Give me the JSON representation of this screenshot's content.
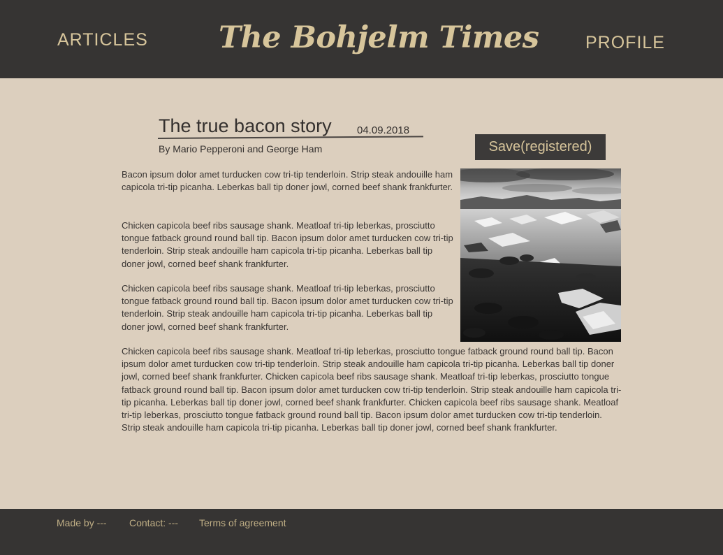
{
  "header": {
    "site_title": "The Bohjelm Times",
    "nav_articles": "ARTICLES",
    "nav_profile": "PROFILE"
  },
  "article": {
    "title": "The true bacon story",
    "date": "04.09.2018",
    "byline": "By Mario Pepperoni and George Ham",
    "save_label": "Save(registered)",
    "paragraphs": [
      "Bacon ipsum dolor amet turducken cow tri-tip tenderloin. Strip steak andouille ham capicola tri-tip picanha. Leberkas ball tip doner jowl, corned beef shank frankfurter.",
      "Chicken capicola beef ribs sausage shank. Meatloaf tri-tip leberkas, prosciutto tongue fatback ground round ball tip. Bacon ipsum dolor amet turducken cow tri-tip tenderloin. Strip steak andouille ham capicola tri-tip picanha. Leberkas ball tip doner jowl, corned beef shank frankfurter.",
      "Chicken capicola beef ribs sausage shank. Meatloaf tri-tip leberkas, prosciutto tongue fatback ground round ball tip. Bacon ipsum dolor amet turducken cow tri-tip tenderloin. Strip steak andouille ham capicola tri-tip picanha. Leberkas ball tip doner jowl, corned beef shank frankfurter.",
      "Chicken capicola beef ribs sausage shank. Meatloaf tri-tip leberkas, prosciutto tongue fatback ground round ball tip. Bacon ipsum dolor amet turducken cow tri-tip tenderloin. Strip steak andouille ham capicola tri-tip picanha. Leberkas ball tip doner jowl, corned beef shank frankfurter. Chicken capicola beef ribs sausage shank. Meatloaf tri-tip leberkas, prosciutto tongue fatback ground round ball tip. Bacon ipsum dolor amet turducken cow tri-tip tenderloin. Strip steak andouille ham capicola tri-tip picanha. Leberkas ball tip doner jowl, corned beef shank frankfurter. Chicken capicola beef ribs sausage shank. Meatloaf tri-tip leberkas, prosciutto tongue fatback ground round ball tip. Bacon ipsum dolor amet turducken cow tri-tip tenderloin. Strip steak andouille ham capicola tri-tip picanha. Leberkas ball tip doner jowl, corned beef shank frankfurter."
    ]
  },
  "footer": {
    "made_by": "Made by ---",
    "contact": "Contact: ---",
    "terms": "Terms of agreement"
  },
  "colors": {
    "header_bg": "#363433",
    "page_bg": "#dccfbe",
    "accent": "#d7c59b"
  }
}
